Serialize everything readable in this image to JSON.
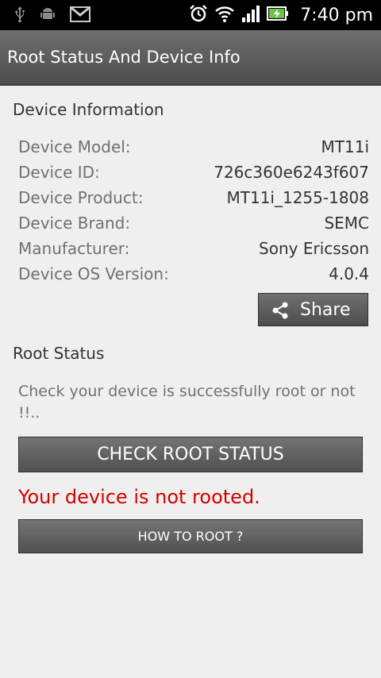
{
  "status_bar": {
    "time": "7:40 pm",
    "icons": [
      "usb-icon",
      "android-debug-icon",
      "gmail-icon",
      "alarm-icon",
      "wifi-icon",
      "signal-icon",
      "battery-charging-icon"
    ]
  },
  "action_bar": {
    "title": "Root Status And Device Info"
  },
  "device_info": {
    "heading": "Device Information",
    "rows": [
      {
        "label": "Device Model:",
        "value": "MT11i"
      },
      {
        "label": "Device ID:",
        "value": "726c360e6243f607"
      },
      {
        "label": "Device Product:",
        "value": "MT11i_1255-1808"
      },
      {
        "label": "Device Brand:",
        "value": "SEMC"
      },
      {
        "label": "Manufacturer:",
        "value": "Sony Ericsson"
      },
      {
        "label": "Device OS Version:",
        "value": "4.0.4"
      }
    ],
    "share_label": "Share"
  },
  "root_status": {
    "heading": "Root Status",
    "description": "Check your device is successfully root or not !!..",
    "check_button": "CHECK ROOT STATUS",
    "result": "Your device is not rooted.",
    "howto_button": "HOW TO ROOT ?"
  },
  "colors": {
    "result_text": "#d40000",
    "action_bar": "#5a5a5a"
  }
}
